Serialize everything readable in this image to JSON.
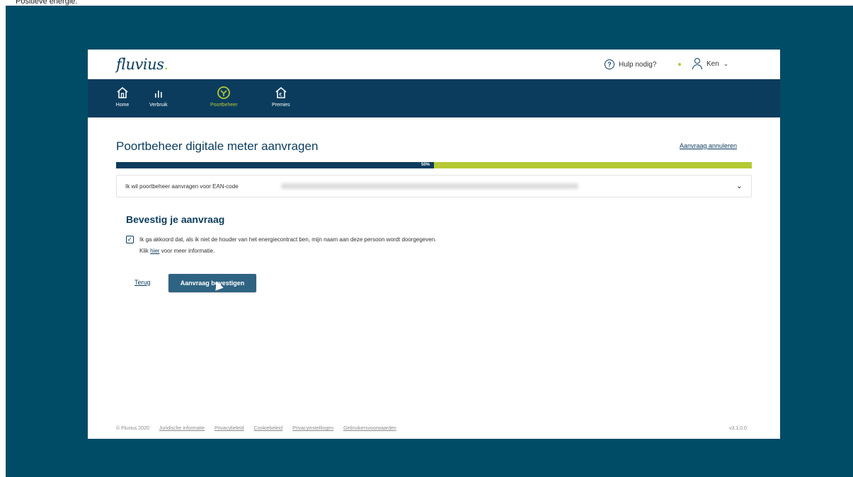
{
  "caption": "Positieve energie.",
  "header": {
    "logo": "fluvius",
    "logo_dot": ".",
    "help_label": "Hulp nodig?",
    "user_name": "Ken"
  },
  "nav": {
    "items": [
      {
        "label": "Home",
        "icon": "home-icon"
      },
      {
        "label": "Verbruik",
        "icon": "bar-chart-icon"
      },
      {
        "label": "Poortbeheer",
        "icon": "meter-icon",
        "active": true
      },
      {
        "label": "Premies",
        "icon": "euro-house-icon"
      }
    ]
  },
  "main": {
    "title": "Poortbeheer digitale meter aanvragen",
    "cancel_label": "Aanvraag annuleren",
    "progress_label": "50%",
    "progress_value": 0.5,
    "ean_text": "Ik wil poortbeheer aanvragen voor EAN-code",
    "confirm_title": "Bevestig je aanvraag",
    "agree_text": "Ik ga akkoord dat, als ik niet de houder van het energiecontract ben, mijn naam aan deze persoon wordt doorgegeven.",
    "info_prefix": "Klik",
    "info_link": "hier",
    "info_suffix": "voor meer informatie.",
    "back_label": "Terug",
    "confirm_button": "Aanvraag bevestigen"
  },
  "footer": {
    "copyright": "© Fluvius 2020",
    "links": [
      "Juridische informatie",
      "Privacybeleid",
      "Cookiebeleid",
      "Privacyinstellingen",
      "Gebruikersvoorwaarden"
    ],
    "version": "v3.1.0.0"
  },
  "colors": {
    "navy": "#0b3c5d",
    "lime": "#b5c934",
    "background": "#004c67",
    "button": "#2f6382"
  }
}
